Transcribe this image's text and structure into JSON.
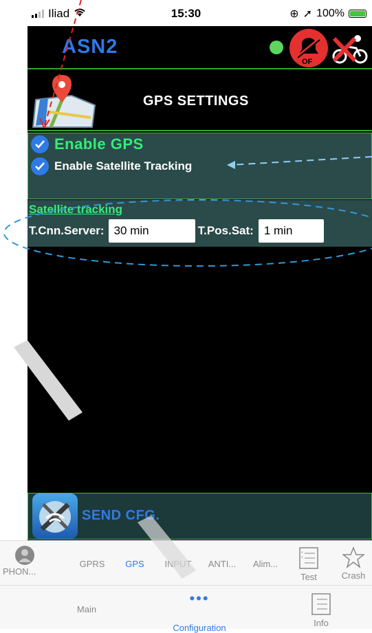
{
  "status": {
    "carrier": "Iliad",
    "time": "15:30",
    "battery": "100%"
  },
  "app": {
    "name": "ASN2",
    "alarm_label": "OF"
  },
  "section": {
    "title": "GPS SETTINGS"
  },
  "gps": {
    "enable_gps": "Enable  GPS",
    "enable_sat": "Enable Satellite Tracking"
  },
  "sat": {
    "title": "Satellite tracking",
    "cnn_label": "T.Cnn.Server:",
    "cnn_value": "30 min",
    "pos_label": "T.Pos.Sat:",
    "pos_value": "1 min"
  },
  "send": {
    "label": "SEND CFG."
  },
  "tabs_top": [
    "PHON...",
    "GPRS",
    "GPS",
    "INPUT",
    "ANTI...",
    "Alim...",
    "Test",
    "Crash"
  ],
  "tabs_bottom": [
    "Main",
    "Configuration",
    "Info"
  ]
}
